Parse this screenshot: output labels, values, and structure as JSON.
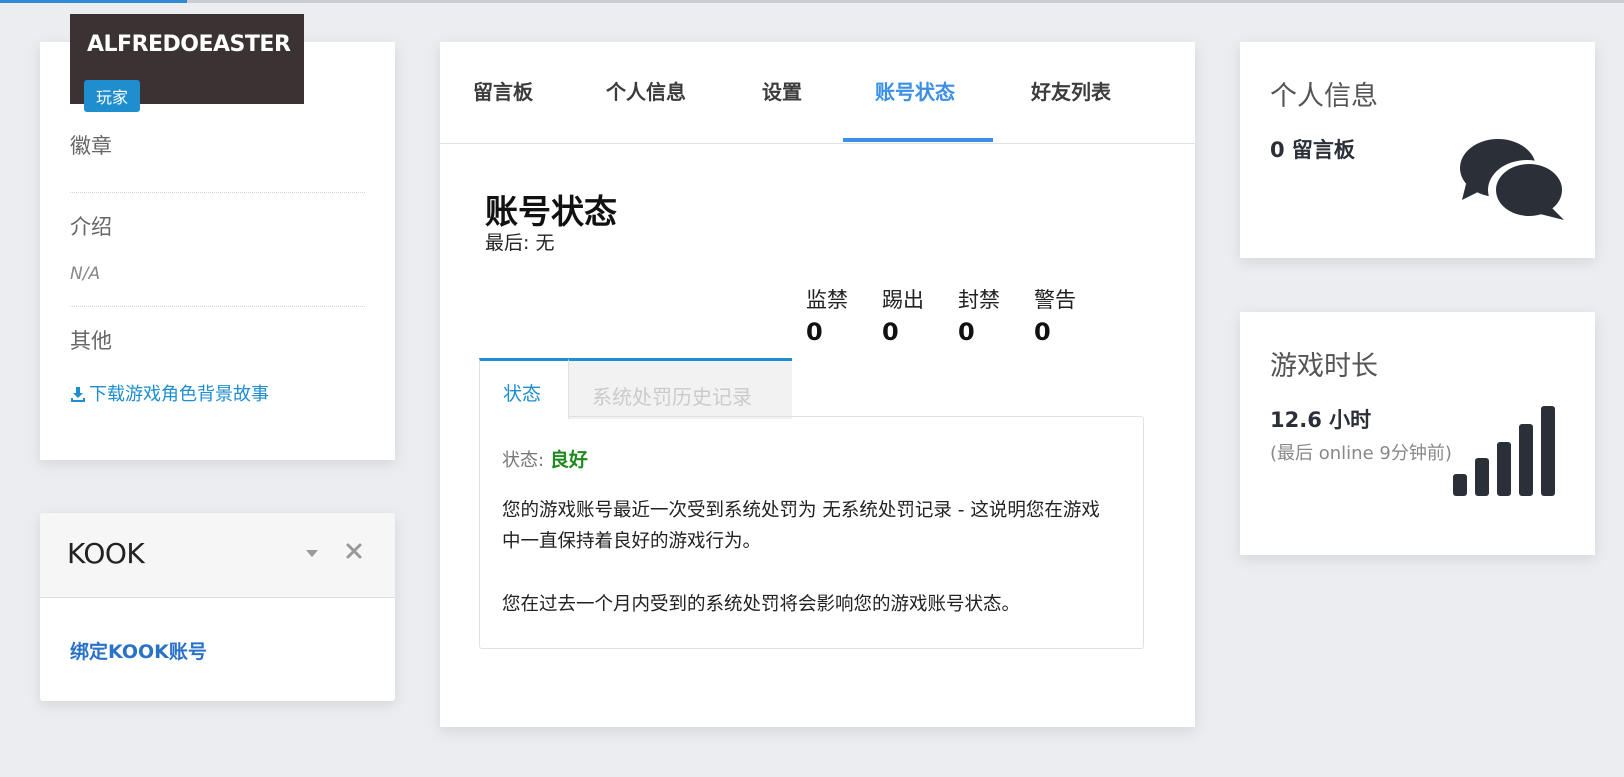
{
  "page_load_progress": 0.115,
  "profile": {
    "username": "ALFREDOEASTER",
    "role": "玩家",
    "badges_label": "徽章",
    "intro_label": "介绍",
    "intro_value": "N/A",
    "other_label": "其他",
    "download_label": "下载游戏角色背景故事"
  },
  "kook": {
    "title": "KOOK",
    "bind_label": "绑定KOOK账号"
  },
  "tabs": [
    "留言板",
    "个人信息",
    "设置",
    "账号状态",
    "好友列表"
  ],
  "active_tab": "账号状态",
  "account_status": {
    "title": "账号状态",
    "last_label": "最后: 无",
    "stats": [
      {
        "label": "监禁",
        "value": "0"
      },
      {
        "label": "踢出",
        "value": "0"
      },
      {
        "label": "封禁",
        "value": "0"
      },
      {
        "label": "警告",
        "value": "0"
      }
    ],
    "subtabs": {
      "status": "状态",
      "history": "系统处罚历史记录"
    },
    "status_label": "状态:",
    "status_value": "良好",
    "description_1": "您的游戏账号最近一次受到系统处罚为 无系统处罚记录 - 这说明您在游戏中一直保持着良好的游戏行为。",
    "description_2": "您在过去一个月内受到的系统处罚将会影响您的游戏账号状态。"
  },
  "info_card": {
    "title": "个人信息",
    "count_text": "0 留言板",
    "icon": "comments-icon"
  },
  "time_card": {
    "title": "游戏时长",
    "value_text": "12.6 小时",
    "sub_text": "(最后 online 9分钟前)",
    "icon": "signal-bars-icon"
  },
  "colors": {
    "accent": "#3b8fe5",
    "link": "#1e8ecf",
    "status_good": "#1f8a1f",
    "banner": "#3b3333",
    "icon_dark": "#2a2f38"
  }
}
